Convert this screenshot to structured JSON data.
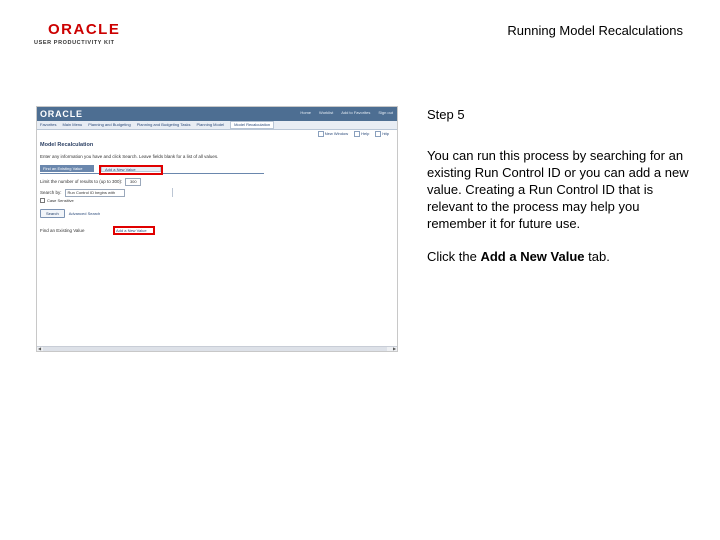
{
  "header": {
    "logo_text": "ORACLE",
    "logo_subtitle": "USER PRODUCTIVITY KIT",
    "title": "Running Model Recalculations"
  },
  "instructions": {
    "step": "Step 5",
    "body": "You can run this process by searching for an existing Run Control ID or you can add a new value. Creating a Run Control ID that is relevant to the process may help you remember it for future use.",
    "click_prefix": "Click the ",
    "click_term": "Add a New Value",
    "click_suffix": " tab."
  },
  "screenshot": {
    "brand": "ORACLE",
    "top_links": [
      "Home",
      "Worklist",
      "Add to Favorites",
      "Sign out"
    ],
    "nav": [
      "Favorites",
      "Main Menu",
      "Planning and Budgeting",
      "Planning and Budgeting Tasks",
      "Planning Model",
      "Model Recalculation"
    ],
    "utility_links": [
      "New Window",
      "Help",
      "http"
    ],
    "page_heading": "Model Recalculation",
    "instruction": "Enter any information you have and click Search. Leave fields blank for a list of all values.",
    "tabs": {
      "find": "Find an Existing Value",
      "add": "Add a New Value"
    },
    "limit_label": "Limit the number of results to (up to 300):",
    "limit_value": "300",
    "search_by_label": "Search by:",
    "search_by_value": "Run Control ID begins with",
    "case_sensitive": "Case Sensitive",
    "search_button": "Search",
    "advanced_link": "Advanced Search",
    "find_by_label": "Find an Existing Value",
    "find_link": "Add a New Value"
  }
}
